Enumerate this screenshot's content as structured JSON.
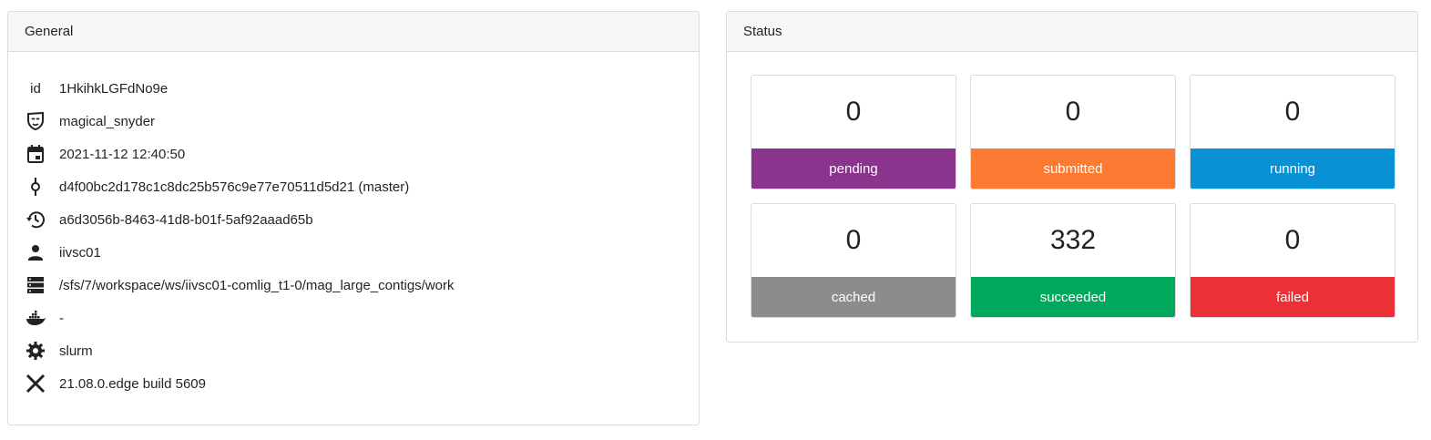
{
  "general": {
    "title": "General",
    "rows": [
      {
        "icon": "id-text-icon",
        "value": "1HkihkLGFdNo9e",
        "icon_text": "id"
      },
      {
        "icon": "mask-icon",
        "value": "magical_snyder"
      },
      {
        "icon": "calendar-icon",
        "value": "2021-11-12 12:40:50"
      },
      {
        "icon": "commit-icon",
        "value": "d4f00bc2d178c1c8dc25b576c9e77e70511d5d21 (master)"
      },
      {
        "icon": "history-icon",
        "value": "a6d3056b-8463-41d8-b01f-5af92aaad65b"
      },
      {
        "icon": "user-icon",
        "value": "iivsc01"
      },
      {
        "icon": "server-icon",
        "value": "/sfs/7/workspace/ws/iivsc01-comlig_t1-0/mag_large_contigs/work"
      },
      {
        "icon": "docker-icon",
        "value": "-"
      },
      {
        "icon": "gear-icon",
        "value": "slurm"
      },
      {
        "icon": "nextflow-icon",
        "value": "21.08.0.edge build 5609"
      }
    ]
  },
  "status": {
    "title": "Status",
    "items": [
      {
        "count": "0",
        "label": "pending",
        "color": "#8b348d"
      },
      {
        "count": "0",
        "label": "submitted",
        "color": "#fd7a33"
      },
      {
        "count": "0",
        "label": "running",
        "color": "#0891d4"
      },
      {
        "count": "0",
        "label": "cached",
        "color": "#8c8c8e"
      },
      {
        "count": "332",
        "label": "succeeded",
        "color": "#00a85b"
      },
      {
        "count": "0",
        "label": "failed",
        "color": "#ec3037"
      }
    ]
  }
}
